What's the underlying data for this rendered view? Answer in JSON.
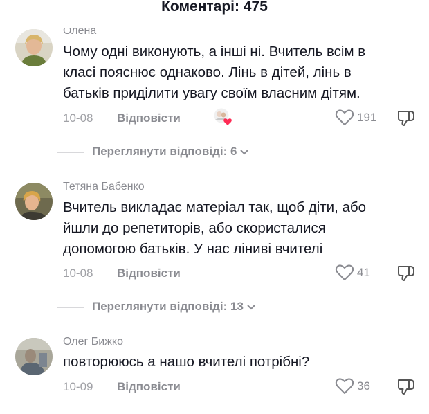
{
  "header": {
    "title": "Коментарі: 475"
  },
  "comments": [
    {
      "author": "Олена",
      "text_lines": [
        "Чому одні виконують, а інші ні. Вчитель всім в",
        "класі пояснює однаково. Лінь в дітей, лінь в",
        "батьків приділити увагу своїм власним дітям."
      ],
      "date": "10-08",
      "reply_label": "Відповісти",
      "likes": "191",
      "liked_by_creator": true
    },
    {
      "author": "Тетяна Бабенко",
      "text_lines": [
        "Вчитель викладає матеріал так, щоб діти, або",
        "йшли до репетиторів, або скористалися",
        "допомогою батьків. У нас ліниві вчителі"
      ],
      "date": "10-08",
      "reply_label": "Відповісти",
      "likes": "41",
      "liked_by_creator": false
    },
    {
      "author": "Олег Бижко",
      "text_lines": [
        "повторююсь а нашо вчителі потрібні?"
      ],
      "date": "10-09",
      "reply_label": "Відповісти",
      "likes": "36",
      "liked_by_creator": false
    }
  ],
  "view_replies": [
    {
      "label": "Переглянути відповіді: 6"
    },
    {
      "label": "Переглянути відповіді: 13"
    }
  ],
  "colors": {
    "text": "#161823",
    "muted": "#8a8b91",
    "heart": "#fe2c55"
  }
}
